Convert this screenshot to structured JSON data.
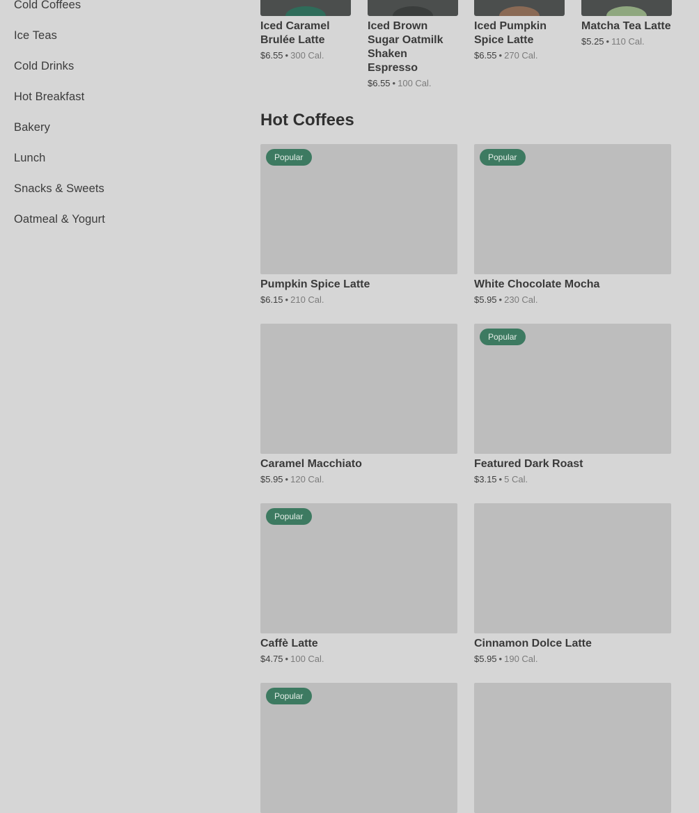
{
  "sidebar": {
    "items": [
      {
        "label": "Cold Coffees"
      },
      {
        "label": "Ice Teas"
      },
      {
        "label": "Cold Drinks"
      },
      {
        "label": "Hot Breakfast"
      },
      {
        "label": "Bakery"
      },
      {
        "label": "Lunch"
      },
      {
        "label": "Snacks & Sweets"
      },
      {
        "label": "Oatmeal & Yogurt"
      }
    ]
  },
  "top_strip": {
    "items": [
      {
        "name": "Iced Caramel Brulée Latte",
        "price": "$6.55",
        "calories": "300 Cal.",
        "cup_color": "#2f6c5a"
      },
      {
        "name": "Iced Brown Sugar Oatmilk Shaken Espresso",
        "price": "$6.55",
        "calories": "100 Cal.",
        "cup_color": "#3a3d3c"
      },
      {
        "name": "Iced Pumpkin Spice Latte",
        "price": "$6.55",
        "calories": "270 Cal.",
        "cup_color": "#8a6a55"
      },
      {
        "name": "Matcha Tea Latte",
        "price": "$5.25",
        "calories": "110 Cal.",
        "cup_color": "#8fa77f"
      }
    ]
  },
  "section": {
    "title": "Hot Coffees",
    "badge_label": "Popular",
    "items": [
      {
        "name": "Pumpkin Spice Latte",
        "price": "$6.15",
        "calories": "210 Cal.",
        "popular": true
      },
      {
        "name": "White Chocolate Mocha",
        "price": "$5.95",
        "calories": "230 Cal.",
        "popular": true
      },
      {
        "name": "Caramel Macchiato",
        "price": "$5.95",
        "calories": "120 Cal.",
        "popular": false
      },
      {
        "name": "Featured Dark Roast",
        "price": "$3.15",
        "calories": "5 Cal.",
        "popular": true
      },
      {
        "name": "Caffè Latte",
        "price": "$4.75",
        "calories": "100 Cal.",
        "popular": true
      },
      {
        "name": "Cinnamon Dolce Latte",
        "price": "$5.95",
        "calories": "190 Cal.",
        "popular": false
      },
      {
        "name": "",
        "price": "",
        "calories": "",
        "popular": true
      },
      {
        "name": "",
        "price": "",
        "calories": "",
        "popular": false
      }
    ]
  },
  "colors": {
    "overlay_background": "#d6d6d6",
    "badge": "#3d7a61",
    "image_placeholder": "#bdbdbd"
  }
}
